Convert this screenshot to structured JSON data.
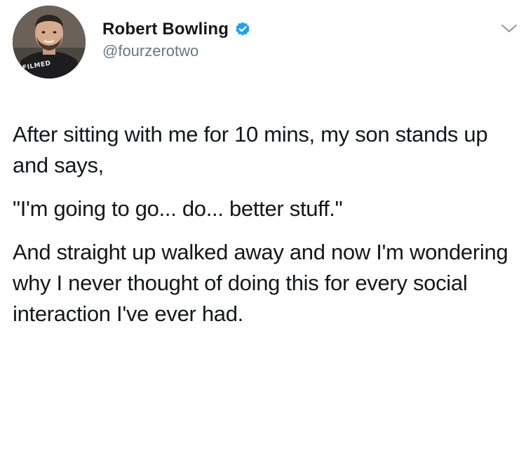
{
  "author": {
    "display_name": "Robert Bowling",
    "handle": "@fourzerotwo",
    "avatar_shirt_text": "FILMED",
    "verified_badge": "verified-badge-icon",
    "badge_color": "#1da1f2"
  },
  "menu": {
    "icon": "chevron-down-icon"
  },
  "tweet": {
    "paragraphs": [
      "After sitting with me for 10 mins, my son stands up and says,",
      "\"I'm going to go... do... better stuff.\"",
      "And straight up walked away and now I'm wondering why I never thought of doing this for every social interaction I've ever had."
    ]
  }
}
